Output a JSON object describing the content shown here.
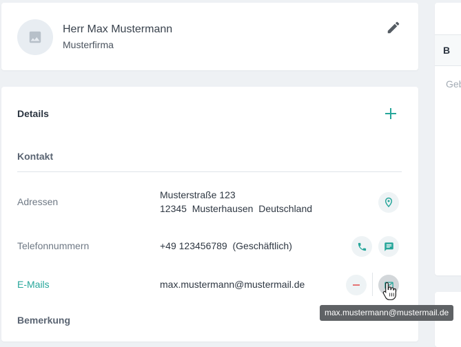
{
  "profile": {
    "name": "Herr Max Mustermann",
    "company": "Musterfirma",
    "avatar_icon": "image-placeholder-icon",
    "edit_icon": "pencil-icon"
  },
  "details": {
    "title": "Details",
    "add_icon": "plus-icon",
    "section_contact": "Kontakt",
    "rows": {
      "addresses": {
        "label": "Adressen",
        "line1": "Musterstraße 123",
        "line2": "12345  Musterhausen  Deutschland",
        "action_icon": "map-pin-icon"
      },
      "phones": {
        "label": "Telefonnummern",
        "value": "+49 123456789  (Geschäftlich)",
        "action_icons": [
          "phone-icon",
          "message-icon"
        ]
      },
      "emails": {
        "label": "E-Mails",
        "value": "max.mustermann@mustermail.de",
        "action_icons": [
          "minus-icon",
          "email-icon"
        ]
      }
    },
    "section_remark": "Bemerkung"
  },
  "tooltip": "max.mustermann@mustermail.de",
  "right_panel": {
    "bold_label": "B",
    "editor_placeholder": "Geb"
  },
  "colors": {
    "accent": "#26a69a",
    "minus": "#e57373",
    "background": "#eef1f4",
    "tooltip_bg": "#5f6265"
  }
}
